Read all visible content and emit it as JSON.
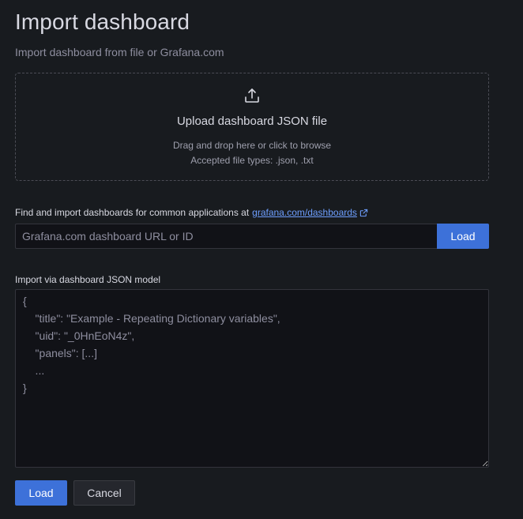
{
  "header": {
    "title": "Import dashboard",
    "subtitle": "Import dashboard from file or Grafana.com"
  },
  "upload": {
    "icon": "upload-icon",
    "title": "Upload dashboard JSON file",
    "hint": "Drag and drop here or click to browse",
    "accepted": "Accepted file types: .json, .txt"
  },
  "gcom": {
    "label": "Find and import dashboards for common applications at",
    "link_text": "grafana.com/dashboards",
    "link_icon": "external-link-icon",
    "placeholder": "Grafana.com dashboard URL or ID",
    "value": "",
    "load_label": "Load"
  },
  "json_model": {
    "label": "Import via dashboard JSON model",
    "placeholder": "{\n    \"title\": \"Example - Repeating Dictionary variables\",\n    \"uid\": \"_0HnEoN4z\",\n    \"panels\": [...]\n    ...\n}",
    "value": ""
  },
  "footer": {
    "load_label": "Load",
    "cancel_label": "Cancel"
  },
  "colors": {
    "background": "#181b1f",
    "primary": "#3d71d9",
    "link": "#6e9fff"
  }
}
